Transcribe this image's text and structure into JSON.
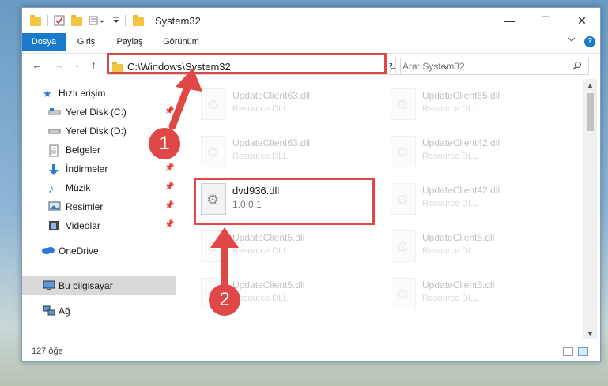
{
  "window": {
    "title": "System32"
  },
  "ribbon": {
    "tabs": [
      "Dosya",
      "Giriş",
      "Paylaş",
      "Görünüm"
    ],
    "help": "?"
  },
  "address": {
    "path": "C:\\Windows\\System32"
  },
  "search": {
    "placeholder": "Ara: System32"
  },
  "nav": {
    "items": [
      {
        "label": "Hızlı erişim"
      },
      {
        "label": "Yerel Disk (C:)"
      },
      {
        "label": "Yerel Disk (D:)"
      },
      {
        "label": "Belgeler"
      },
      {
        "label": "İndirmeler"
      },
      {
        "label": "Müzik"
      },
      {
        "label": "Resimler"
      },
      {
        "label": "Videolar"
      },
      {
        "label": "OneDrive"
      },
      {
        "label": "Bu bilgisayar"
      },
      {
        "label": "Ağ"
      }
    ]
  },
  "files": [
    {
      "name": "UpdateClient63.dll",
      "desc": "Resource DLL"
    },
    {
      "name": "UpdateClient65.dll",
      "desc": "Resource DLL"
    },
    {
      "name": "UpdateClient63.dll",
      "desc": "Resource DLL"
    },
    {
      "name": "UpdateClient42.dll",
      "desc": "Resource DLL"
    },
    {
      "name": "dvd936.dll",
      "desc": "1.0.0.1"
    },
    {
      "name": "UpdateClient42.dll",
      "desc": "Resource DLL"
    },
    {
      "name": "UpdateClient5.dll",
      "desc": "Resource DLL"
    },
    {
      "name": "UpdateClient5.dll",
      "desc": "Resource DLL"
    },
    {
      "name": "UpdateClient5.dll",
      "desc": "Resource DLL"
    },
    {
      "name": "UpdateClient5.dll",
      "desc": "Resource DLL"
    }
  ],
  "status": {
    "count": "127 öğe"
  },
  "annotations": {
    "callout1": "1",
    "callout2": "2",
    "color": "#e04848"
  }
}
